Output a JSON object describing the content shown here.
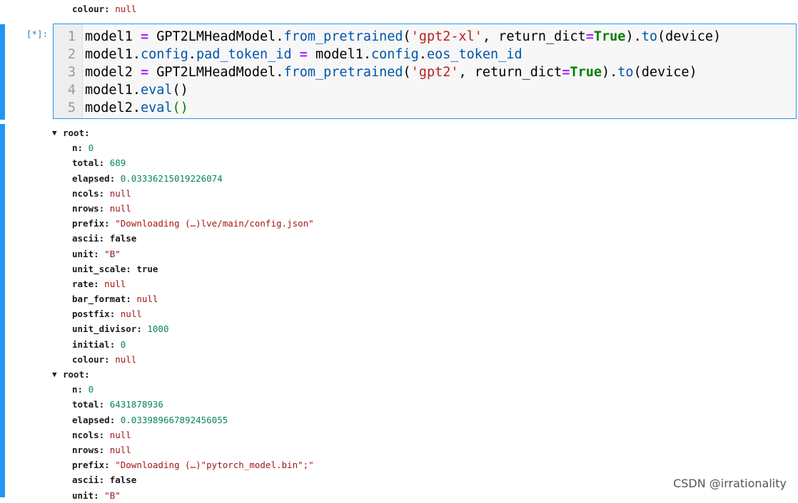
{
  "previous_output_tail": {
    "key": "colour",
    "value": "null"
  },
  "input_cell": {
    "prompt": "[*]:",
    "lines": [
      {
        "num": "1",
        "tokens": [
          {
            "t": "model1 ",
            "c": ""
          },
          {
            "t": "=",
            "c": "op"
          },
          {
            "t": " GPT2LMHeadModel",
            "c": ""
          },
          {
            "t": ".",
            "c": ""
          },
          {
            "t": "from_pretrained",
            "c": "attr"
          },
          {
            "t": "(",
            "c": ""
          },
          {
            "t": "'gpt2-xl'",
            "c": "str"
          },
          {
            "t": ", return_dict",
            "c": ""
          },
          {
            "t": "=",
            "c": "op"
          },
          {
            "t": "True",
            "c": "kw"
          },
          {
            "t": ").",
            "c": ""
          },
          {
            "t": "to",
            "c": "attr"
          },
          {
            "t": "(device)",
            "c": ""
          }
        ]
      },
      {
        "num": "2",
        "tokens": [
          {
            "t": "model1",
            "c": ""
          },
          {
            "t": ".",
            "c": ""
          },
          {
            "t": "config",
            "c": "attr"
          },
          {
            "t": ".",
            "c": ""
          },
          {
            "t": "pad_token_id",
            "c": "attr"
          },
          {
            "t": " ",
            "c": ""
          },
          {
            "t": "=",
            "c": "op"
          },
          {
            "t": " model1",
            "c": ""
          },
          {
            "t": ".",
            "c": ""
          },
          {
            "t": "config",
            "c": "attr"
          },
          {
            "t": ".",
            "c": ""
          },
          {
            "t": "eos_token_id",
            "c": "attr"
          }
        ]
      },
      {
        "num": "3",
        "tokens": [
          {
            "t": "model2 ",
            "c": ""
          },
          {
            "t": "=",
            "c": "op"
          },
          {
            "t": " GPT2LMHeadModel",
            "c": ""
          },
          {
            "t": ".",
            "c": ""
          },
          {
            "t": "from_pretrained",
            "c": "attr"
          },
          {
            "t": "(",
            "c": ""
          },
          {
            "t": "'gpt2'",
            "c": "str"
          },
          {
            "t": ", return_dict",
            "c": ""
          },
          {
            "t": "=",
            "c": "op"
          },
          {
            "t": "True",
            "c": "kw"
          },
          {
            "t": ").",
            "c": ""
          },
          {
            "t": "to",
            "c": "attr"
          },
          {
            "t": "(device)",
            "c": ""
          }
        ]
      },
      {
        "num": "4",
        "tokens": [
          {
            "t": "model1",
            "c": ""
          },
          {
            "t": ".",
            "c": ""
          },
          {
            "t": "eval",
            "c": "attr"
          },
          {
            "t": "()",
            "c": ""
          }
        ]
      },
      {
        "num": "5",
        "tokens": [
          {
            "t": "model2",
            "c": ""
          },
          {
            "t": ".",
            "c": ""
          },
          {
            "t": "eval",
            "c": "attr"
          },
          {
            "t": "()",
            "c": "bracket-match"
          }
        ]
      }
    ]
  },
  "output": {
    "root_label": "root:",
    "caret_icon": "triangle-down-icon",
    "trees": [
      {
        "rows": [
          {
            "key": "n",
            "value": "0",
            "type": "num"
          },
          {
            "key": "total",
            "value": "689",
            "type": "num"
          },
          {
            "key": "elapsed",
            "value": "0.03336215019226074",
            "type": "num"
          },
          {
            "key": "ncols",
            "value": "null",
            "type": "null"
          },
          {
            "key": "nrows",
            "value": "null",
            "type": "null"
          },
          {
            "key": "prefix",
            "value": "\"Downloading (…)lve/main/config.json\"",
            "type": "str"
          },
          {
            "key": "ascii",
            "value": "false",
            "type": "bool"
          },
          {
            "key": "unit",
            "value": "\"B\"",
            "type": "str"
          },
          {
            "key": "unit_scale",
            "value": "true",
            "type": "bool"
          },
          {
            "key": "rate",
            "value": "null",
            "type": "null"
          },
          {
            "key": "bar_format",
            "value": "null",
            "type": "null"
          },
          {
            "key": "postfix",
            "value": "null",
            "type": "null"
          },
          {
            "key": "unit_divisor",
            "value": "1000",
            "type": "num"
          },
          {
            "key": "initial",
            "value": "0",
            "type": "num"
          },
          {
            "key": "colour",
            "value": "null",
            "type": "null"
          }
        ]
      },
      {
        "rows": [
          {
            "key": "n",
            "value": "0",
            "type": "num"
          },
          {
            "key": "total",
            "value": "6431878936",
            "type": "num"
          },
          {
            "key": "elapsed",
            "value": "0.033989667892456055",
            "type": "num"
          },
          {
            "key": "ncols",
            "value": "null",
            "type": "null"
          },
          {
            "key": "nrows",
            "value": "null",
            "type": "null"
          },
          {
            "key": "prefix",
            "value": "\"Downloading (…)\"pytorch_model.bin\";\"",
            "type": "str"
          },
          {
            "key": "ascii",
            "value": "false",
            "type": "bool"
          },
          {
            "key": "unit",
            "value": "\"B\"",
            "type": "str"
          }
        ]
      }
    ]
  },
  "watermark": "CSDN @irrationality",
  "colors": {
    "accent": "#2196f3",
    "keyword": "#008000",
    "operator": "#aa22ff",
    "attribute": "#0055aa",
    "string": "#ba2121",
    "json_number": "#098658",
    "json_null": "#a31515"
  }
}
